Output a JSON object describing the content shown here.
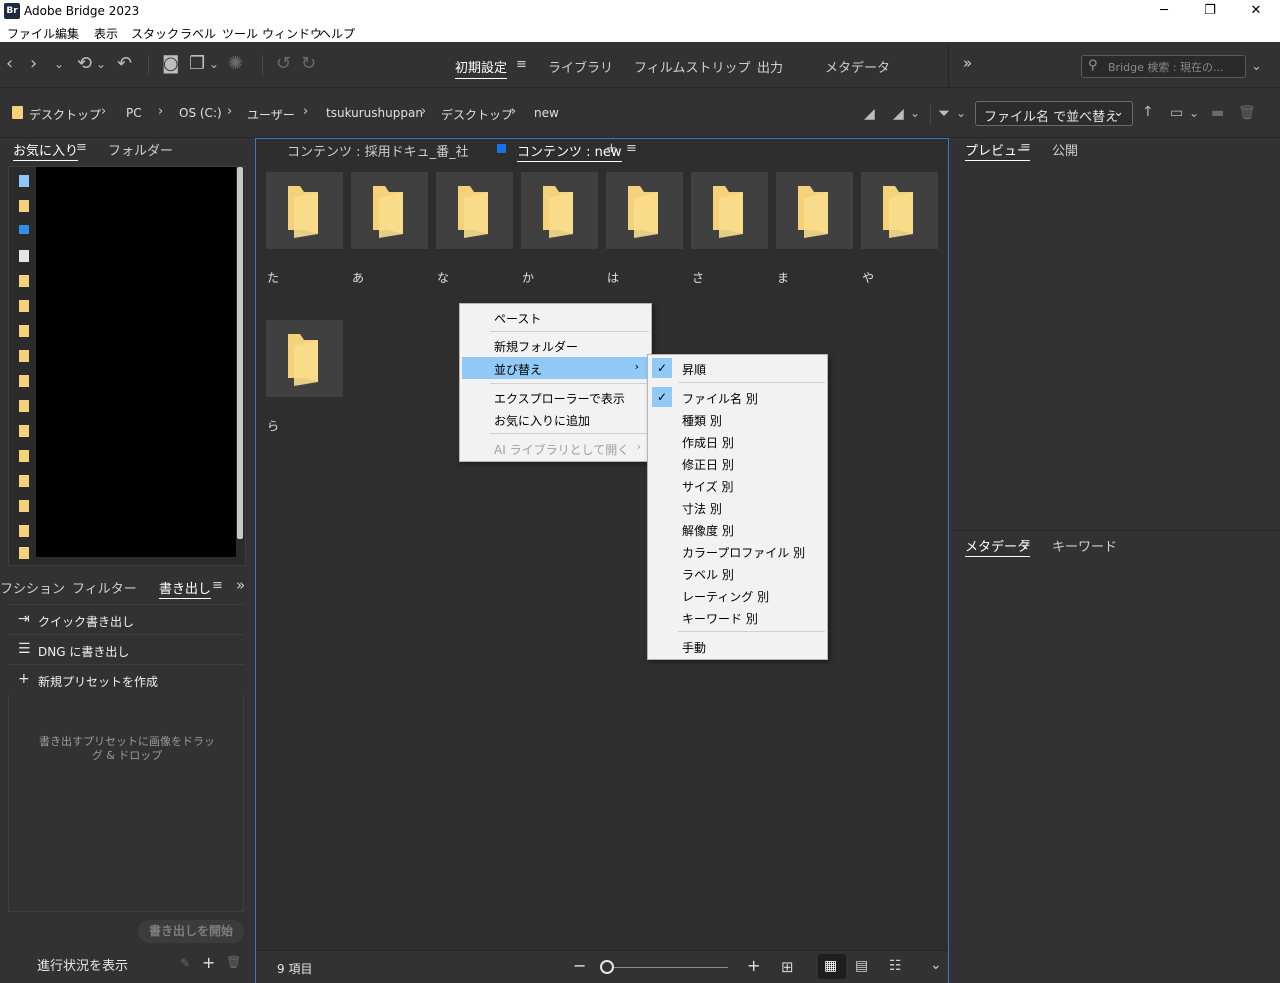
{
  "window": {
    "title": "Adobe Bridge 2023",
    "logo": "Br",
    "minimize": "─",
    "restore": "❐",
    "close": "✕"
  },
  "menu": [
    "ファイル",
    "編集",
    "表示",
    "スタック",
    "ラベル",
    "ツール",
    "ウィンドウ",
    "ヘルプ"
  ],
  "workspaces": {
    "tabs": [
      "初期設定",
      "ライブラリ",
      "フィルムストリップ",
      "出力",
      "メタデータ"
    ],
    "active": "初期設定",
    "menu_icon": "≡",
    "more": "»"
  },
  "search": {
    "placeholder": "Bridge 検索 : 現在の..."
  },
  "breadcrumb": [
    "デスクトップ",
    "PC",
    "OS (C:)",
    "ユーザー",
    "tsukurushuppan",
    "デスクトップ",
    "new"
  ],
  "sort": {
    "label": "ファイル名 で並べ替え"
  },
  "left_top_tabs": {
    "favorites": "お気に入り",
    "menu_icon": "≡",
    "folders": "フォルダー"
  },
  "left_bottom_tabs": {
    "collections": "フシション",
    "filter": "フィルター",
    "export": "書き出し",
    "menu_icon": "≡",
    "more": "»"
  },
  "export": {
    "items": [
      {
        "icon": "export-icon",
        "label": "クイック書き出し"
      },
      {
        "icon": "list-icon",
        "label": "DNG に書き出し"
      },
      {
        "icon": "plus-icon",
        "label": "新規プリセットを作成"
      }
    ],
    "hint": "書き出すプリセットに画像をドラッグ & ドロップ",
    "start": "書き出しを開始",
    "progress": "進行状況を表示"
  },
  "content_tabs": [
    {
      "label": "コンテンツ : 採用ドキュ_番_社"
    },
    {
      "label": "コンテンツ : new"
    }
  ],
  "content_tab_add": "+",
  "content_tab_menu": "≡",
  "folders": [
    "た",
    "あ",
    "な",
    "か",
    "は",
    "さ",
    "ま",
    "や",
    "ら"
  ],
  "status": {
    "count": "9 項目"
  },
  "context_menu": {
    "items": [
      "ペースト",
      "新規フォルダー",
      "並び替え",
      "エクスプローラーで表示",
      "お気に入りに追加",
      "AI ライブラリとして開く"
    ]
  },
  "sort_submenu": {
    "items": [
      "昇順",
      "ファイル名 別",
      "種類 別",
      "作成日 別",
      "修正日 別",
      "サイズ 別",
      "寸法 別",
      "解像度 別",
      "カラープロファイル 別",
      "ラベル 別",
      "レーティング 別",
      "キーワード 別",
      "手動"
    ],
    "checked": [
      "昇順",
      "ファイル名 別"
    ]
  },
  "right_top_tabs": {
    "preview": "プレビュー",
    "menu_icon": "≡",
    "publish": "公開"
  },
  "right_bottom_tabs": {
    "metadata": "メタデータ",
    "menu_icon": "≡",
    "keywords": "キーワード"
  },
  "colors": {
    "accent": "#3b75c4",
    "highlight": "#91c9f7",
    "folder": "#f5d27a"
  }
}
